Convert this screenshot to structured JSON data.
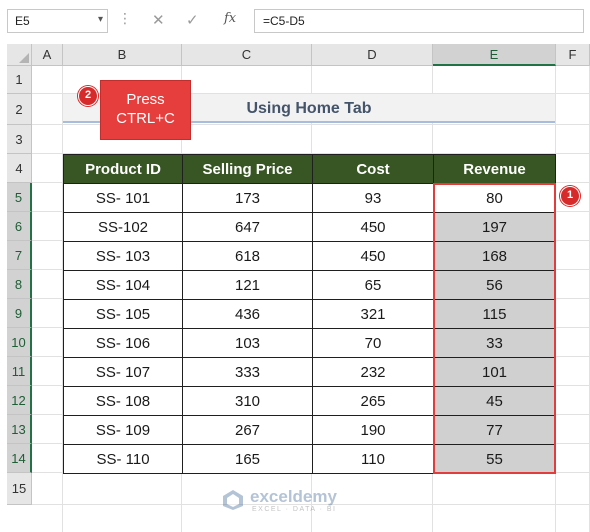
{
  "formula_bar": {
    "name_box": "E5",
    "name_box_caret": "▾",
    "separator_dots": "⋮",
    "cancel_glyph": "✕",
    "enter_glyph": "✓",
    "fx_label": "fx",
    "formula": "=C5-D5"
  },
  "columns": [
    "A",
    "B",
    "C",
    "D",
    "E",
    "F"
  ],
  "rows": [
    "1",
    "2",
    "3",
    "4",
    "5",
    "6",
    "7",
    "8",
    "9",
    "10",
    "11",
    "12",
    "13",
    "14",
    "15"
  ],
  "active_cell": "E5",
  "title": "Using Home Tab",
  "table": {
    "headers": [
      "Product ID",
      "Selling Price",
      "Cost",
      "Revenue"
    ],
    "rows": [
      [
        "SS- 101",
        "173",
        "93",
        "80"
      ],
      [
        "SS-102",
        "647",
        "450",
        "197"
      ],
      [
        "SS- 103",
        "618",
        "450",
        "168"
      ],
      [
        "SS- 104",
        "121",
        "65",
        "56"
      ],
      [
        "SS- 105",
        "436",
        "321",
        "115"
      ],
      [
        "SS- 106",
        "103",
        "70",
        "33"
      ],
      [
        "SS- 107",
        "333",
        "232",
        "101"
      ],
      [
        "SS- 108",
        "310",
        "265",
        "45"
      ],
      [
        "SS- 109",
        "267",
        "190",
        "77"
      ],
      [
        "SS- 110",
        "165",
        "110",
        "55"
      ]
    ]
  },
  "callouts": {
    "press_line1": "Press",
    "press_line2": "CTRL+C",
    "step1": "1",
    "step2": "2"
  },
  "watermark": {
    "name": "exceldemy",
    "tagline": "EXCEL · DATA · BI"
  },
  "colors": {
    "header_fill": "#375623",
    "selection_border": "#e23c3c",
    "selected_fill": "#d0d0d0",
    "title_color": "#44546a",
    "callout_fill": "#e63d3d"
  }
}
